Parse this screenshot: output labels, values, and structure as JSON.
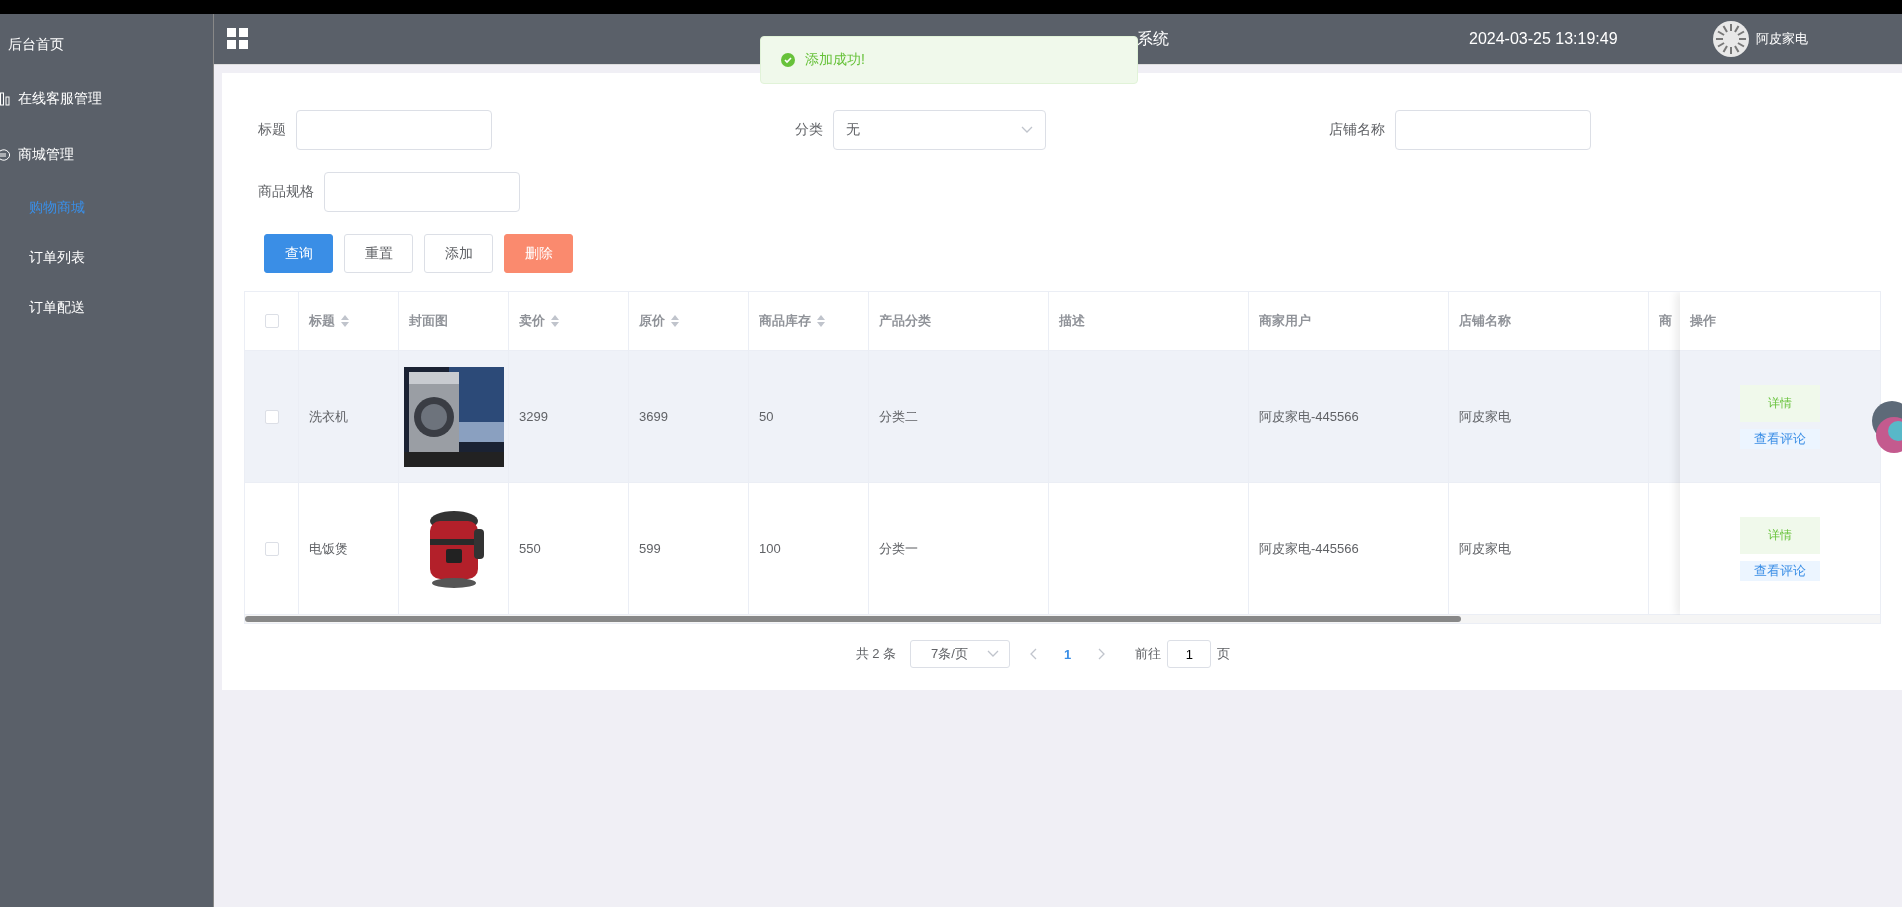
{
  "sidebar": {
    "items": [
      {
        "label": "后台首页",
        "selected": false
      },
      {
        "label": "在线客服管理",
        "selected": false
      },
      {
        "label": "商城管理",
        "selected": false,
        "children": [
          {
            "label": "购物商城",
            "selected": true
          },
          {
            "label": "订单列表",
            "selected": false
          },
          {
            "label": "订单配送",
            "selected": false
          }
        ]
      }
    ]
  },
  "header": {
    "title": "系统",
    "datetime": "2024-03-25 13:19:49",
    "user": "阿皮家电"
  },
  "toast": {
    "message": "添加成功!"
  },
  "filters": [
    {
      "label": "标题",
      "kind": "input"
    },
    {
      "label": "分类",
      "kind": "select",
      "value": "无"
    },
    {
      "label": "店铺名称",
      "kind": "input"
    },
    {
      "label": "商品规格",
      "kind": "input"
    }
  ],
  "actions": [
    {
      "label": "查询",
      "kind": "primary"
    },
    {
      "label": "重置",
      "kind": "plain"
    },
    {
      "label": "添加",
      "kind": "plain"
    },
    {
      "label": "删除",
      "kind": "danger"
    }
  ],
  "table": {
    "all_checked": false,
    "columns": [
      {
        "label": "标题",
        "sortable": true
      },
      {
        "label": "封面图",
        "sortable": false
      },
      {
        "label": "卖价",
        "sortable": true
      },
      {
        "label": "原价",
        "sortable": true
      },
      {
        "label": "商品库存",
        "sortable": true
      },
      {
        "label": "产品分类",
        "sortable": false
      },
      {
        "label": "描述",
        "sortable": false
      },
      {
        "label": "商家用户",
        "sortable": false
      },
      {
        "label": "店铺名称",
        "sortable": false
      },
      {
        "label": "商",
        "sortable": false
      },
      {
        "label": "操作",
        "sortable": false
      }
    ],
    "rows": [
      {
        "checked": false,
        "hover": true,
        "title": "洗衣机",
        "cover": {
          "kind": "picture"
        },
        "price": "3299",
        "original": "3699",
        "stock": "50",
        "category": "分类二",
        "merchant": "阿皮家电-445566",
        "shop": "阿皮家电",
        "buttons": [
          "详情",
          "查看评论"
        ]
      },
      {
        "checked": false,
        "hover": false,
        "title": "电饭煲",
        "cover": {
          "kind": "picture"
        },
        "price": "550",
        "original": "599",
        "stock": "100",
        "category": "分类一",
        "merchant": "阿皮家电-445566",
        "shop": "阿皮家电",
        "buttons": [
          "详情",
          "查看评论"
        ]
      }
    ]
  },
  "pagination": {
    "total": "共 2 条",
    "page_size": "7条/页",
    "pages": [
      {
        "label": "1",
        "selected": true
      }
    ],
    "goto_label": "前往",
    "goto_value": "1",
    "goto_suffix": "页"
  }
}
